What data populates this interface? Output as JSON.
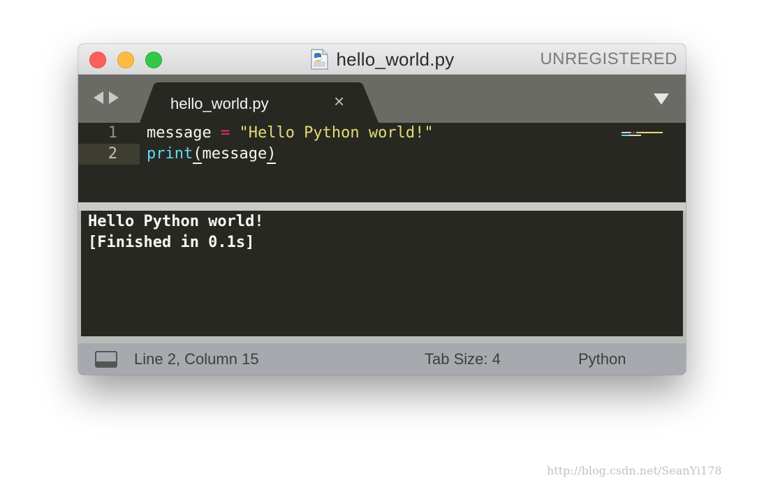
{
  "window": {
    "title": "hello_world.py",
    "registration_status": "UNREGISTERED",
    "file_icon": "python-file-icon"
  },
  "tab_bar": {
    "nav_back_icon": "triangle-left-icon",
    "nav_forward_icon": "triangle-right-icon",
    "tabs": [
      {
        "label": "hello_world.py",
        "close_glyph": "×",
        "active": true
      }
    ],
    "menu_icon": "triangle-down-icon"
  },
  "editor": {
    "lines": [
      {
        "number": "1",
        "tokens": {
          "var": "message",
          "op": "=",
          "str": "\"Hello Python world!\""
        }
      },
      {
        "number": "2",
        "current": true,
        "tokens": {
          "fn": "print",
          "open": "(",
          "arg": "message",
          "close": ")"
        }
      }
    ]
  },
  "output": {
    "lines": [
      "Hello Python world!",
      "[Finished in 0.1s]"
    ]
  },
  "status_bar": {
    "panel_toggle_icon": "panel-toggle-icon",
    "position": "Line 2, Column 15",
    "tab_size": "Tab Size: 4",
    "syntax": "Python"
  },
  "watermark": "http://blog.csdn.net/SeanYi178",
  "colors": {
    "background": "#272822",
    "keyword_pink": "#f92672",
    "string_yellow": "#e6db74",
    "function_cyan": "#66d9ef",
    "text": "#f8f8f2",
    "close_red": "#fc605c",
    "minimize_yellow": "#fdbc40",
    "zoom_green": "#34c84a"
  }
}
